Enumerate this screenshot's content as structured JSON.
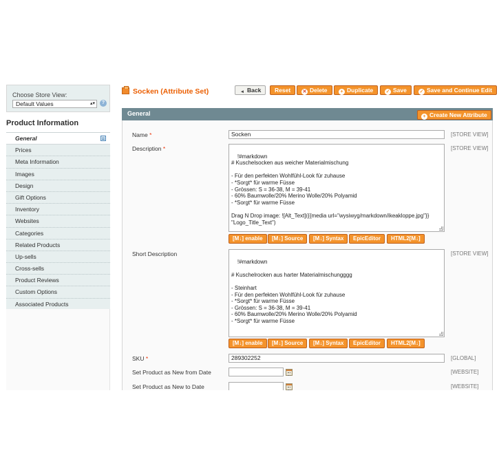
{
  "sidebar": {
    "store_label": "Choose Store View:",
    "store_value": "Default Values",
    "section_title": "Product Information",
    "tabs": [
      {
        "label": "General"
      },
      {
        "label": "Prices"
      },
      {
        "label": "Meta Information"
      },
      {
        "label": "Images"
      },
      {
        "label": "Design"
      },
      {
        "label": "Gift Options"
      },
      {
        "label": "Inventory"
      },
      {
        "label": "Websites"
      },
      {
        "label": "Categories"
      },
      {
        "label": "Related Products"
      },
      {
        "label": "Up-sells"
      },
      {
        "label": "Cross-sells"
      },
      {
        "label": "Product Reviews"
      },
      {
        "label": "Custom Options"
      },
      {
        "label": "Associated Products"
      }
    ]
  },
  "header": {
    "title": "Socken (Attribute Set)",
    "buttons": {
      "back": "Back",
      "reset": "Reset",
      "delete": "Delete",
      "duplicate": "Duplicate",
      "save": "Save",
      "save_continue": "Save and Continue Edit"
    }
  },
  "section": {
    "title": "General",
    "create_attribute": "Create New Attribute"
  },
  "editor_buttons": [
    "[M↓] enable",
    "[M↓] Source",
    "[M↓] Syntax",
    "EpicEditor",
    "HTML2[M↓]"
  ],
  "form": {
    "name": {
      "label": "Name",
      "required": "*",
      "value": "Socken",
      "scope": "[STORE VIEW]"
    },
    "description": {
      "label": "Description",
      "required": "*",
      "scope": "[STORE VIEW]",
      "value": "!#markdown\n# Kuschelsocken aus weicher Materialmischung\n\n- Für den perfekten Wohlfühl-Look für zuhause\n- *Sorgt* für warme Füsse\n- Grössen: S = 36-38, M = 39-41\n- 60% Baumwolle/20% Merino Wolle/20% Polyamid\n- *Sorgt* für warme Füsse\n\nDrag N Drop image: ![Alt_Text]({{media url=\"wysiwyg/markdown/ikeakloppe.jpg\"}}\n\"Logo_Title_Text\")"
    },
    "short_description": {
      "label": "Short Description",
      "scope": "[STORE VIEW]",
      "value": "!#markdown\n\n# Kuschelrocken aus harter Materialmischungggg\n\n- Steinhart\n- Für den perfekten Wohlfühl-Look für zuhause\n- *Sorgt* für warme Füsse\n- Grössen: S = 36-38, M = 39-41\n- 60% Baumwolle/20% Merino Wolle/20% Polyamid\n- *Sorgt* für warme Füsse"
    },
    "sku": {
      "label": "SKU",
      "required": "*",
      "value": "289302252",
      "scope": "[GLOBAL]"
    },
    "new_from": {
      "label": "Set Product as New from Date",
      "value": "",
      "scope": "[WEBSITE]"
    },
    "new_to": {
      "label": "Set Product as New to Date",
      "value": "",
      "scope": "[WEBSITE]"
    }
  },
  "colors": {
    "accent": "#eb5e00",
    "button": "#f4932b",
    "section_header": "#6f8992",
    "sidebar_bg": "#e7efef"
  }
}
